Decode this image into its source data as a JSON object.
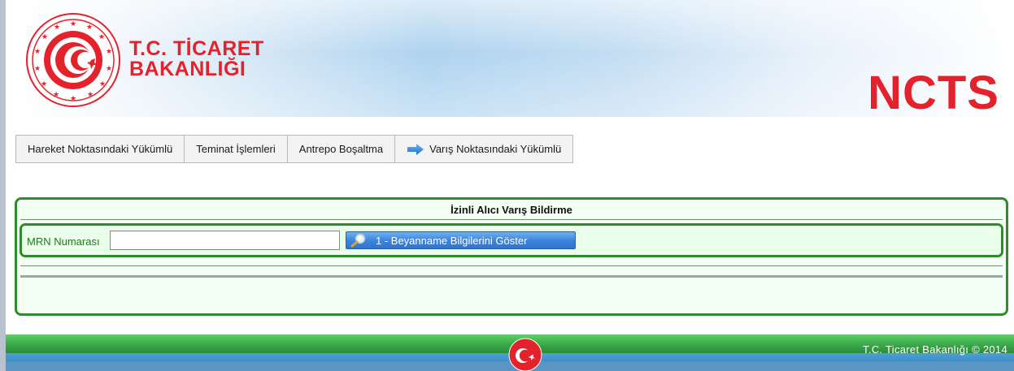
{
  "header": {
    "ministry_line1": "T.C. TİCARET",
    "ministry_line2": "BAKANLIĞI",
    "app_title": "NCTS",
    "brand_color": "#e3222b"
  },
  "tabs": [
    {
      "label": "Hareket Noktasındaki Yükümlü",
      "icon": null
    },
    {
      "label": "Teminat İşlemleri",
      "icon": null
    },
    {
      "label": "Antrepo Boşaltma",
      "icon": null
    },
    {
      "label": "Varış Noktasındaki Yükümlü",
      "icon": "arrow-right-icon",
      "active": true
    }
  ],
  "panel": {
    "title": "İzinli Alıcı Varış Bildirme",
    "mrn_label": "MRN Numarası",
    "mrn_value": "",
    "show_button_label": "1 - Beyanname Bilgilerini Göster",
    "border_color": "#2e8b2e",
    "background_color": "#f3fff3"
  },
  "footer": {
    "copyright": "T.C. Ticaret Bakanlığı © 2014"
  }
}
